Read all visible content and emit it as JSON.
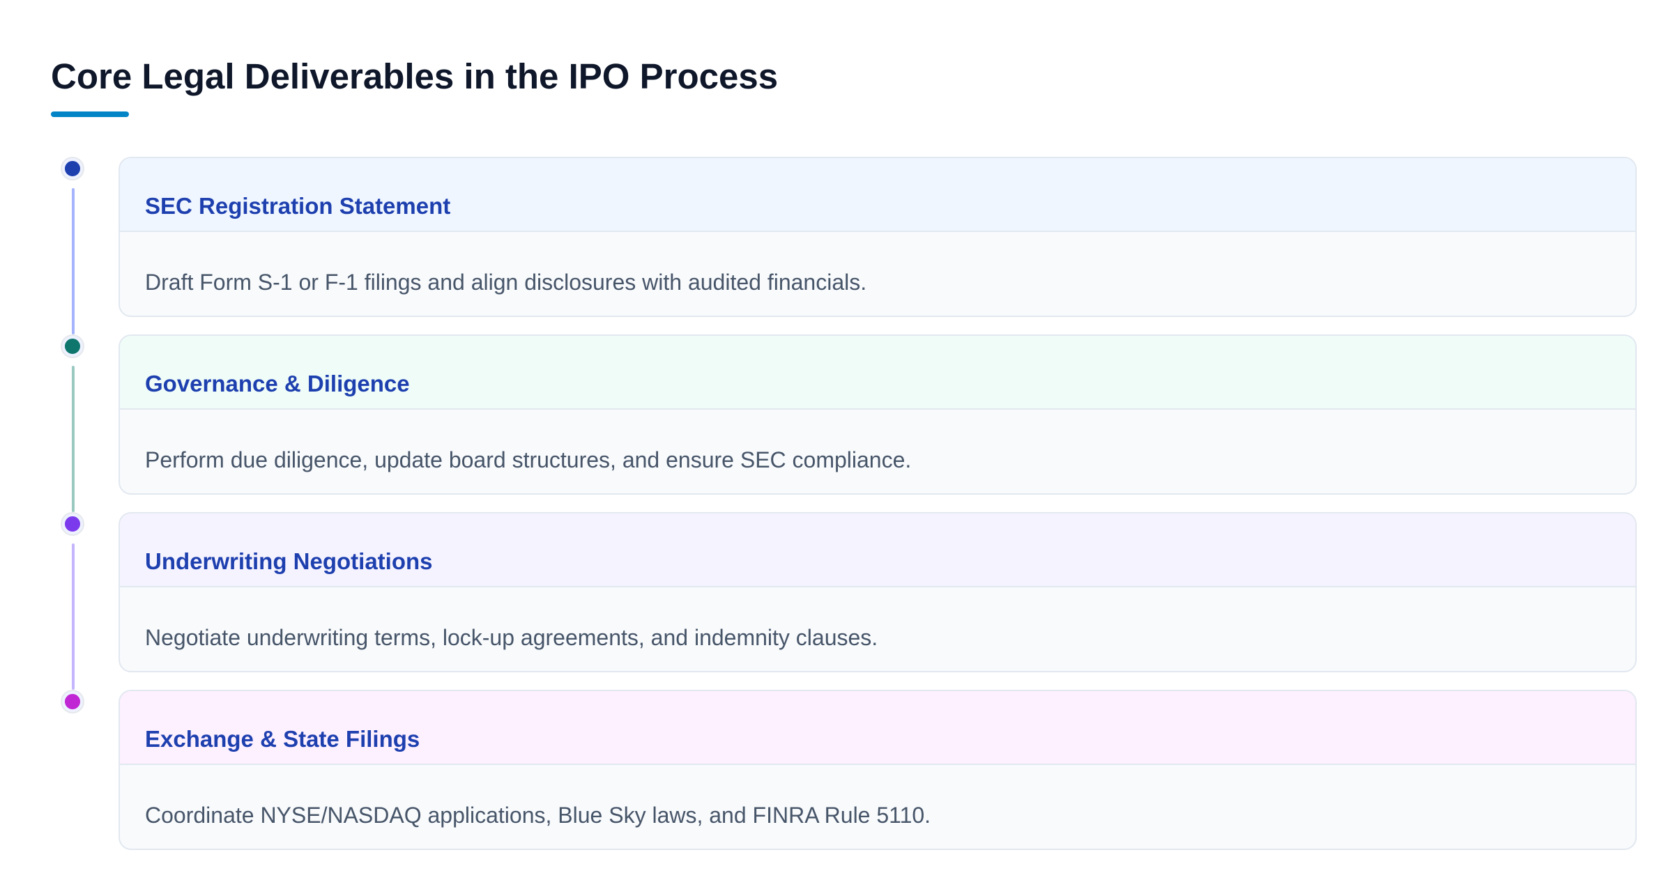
{
  "page": {
    "title": "Core Legal Deliverables in the IPO Process",
    "accent": "#0284c7"
  },
  "steps": [
    {
      "title": "SEC Registration Statement",
      "description": "Draft Form S-1 or F-1 filings and align disclosures with audited financials.",
      "dot_color": "#1e40af",
      "line_color": "#a5b4fc",
      "header_bg": "#eff6ff"
    },
    {
      "title": "Governance & Diligence",
      "description": "Perform due diligence, update board structures, and ensure SEC compliance.",
      "dot_color": "#0f766e",
      "line_color": "#99c9c1",
      "header_bg": "#effcf8"
    },
    {
      "title": "Underwriting Negotiations",
      "description": "Negotiate underwriting terms, lock-up agreements, and indemnity clauses.",
      "dot_color": "#7c3aed",
      "line_color": "#c4b5fd",
      "header_bg": "#f5f3ff"
    },
    {
      "title": "Exchange & State Filings",
      "description": "Coordinate NYSE/NASDAQ applications, Blue Sky laws, and FINRA Rule 5110.",
      "dot_color": "#c026d3",
      "line_color": null,
      "header_bg": "#fdf0ff"
    }
  ]
}
